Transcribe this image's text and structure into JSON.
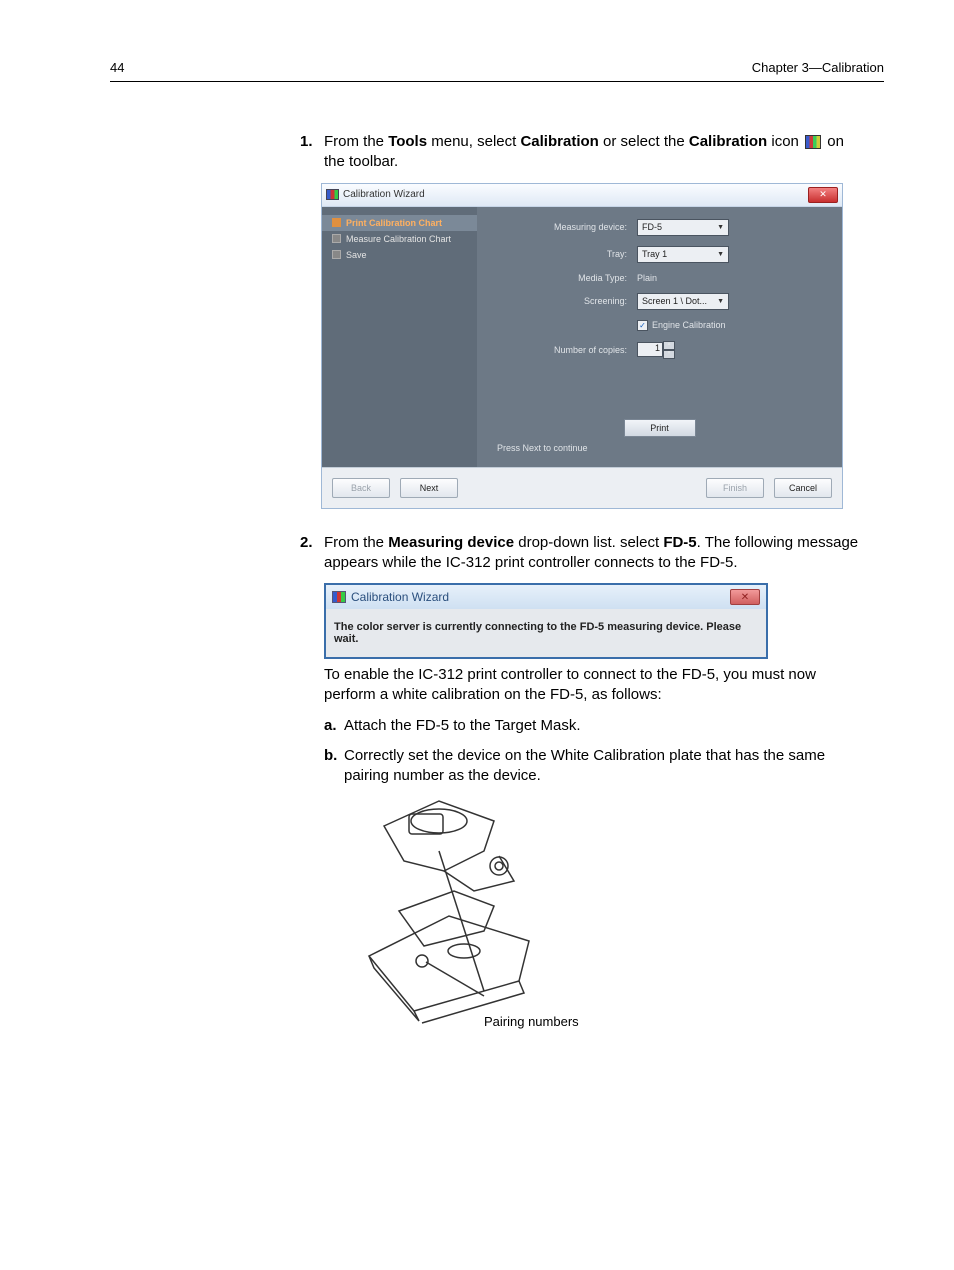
{
  "header": {
    "page_number": "44",
    "chapter": "Chapter 3—Calibration"
  },
  "step1": {
    "num": "1.",
    "t1": "From the ",
    "b1": "Tools",
    "t2": " menu, select ",
    "b2": "Calibration",
    "t3": " or select the ",
    "b3": "Calibration",
    "t4": " icon ",
    "t5": " on the toolbar."
  },
  "dialog1": {
    "title": "Calibration Wizard",
    "steps": {
      "s1": "Print Calibration Chart",
      "s2": "Measure Calibration Chart",
      "s3": "Save"
    },
    "labels": {
      "measuring_device": "Measuring device:",
      "tray": "Tray:",
      "media_type": "Media Type:",
      "screening": "Screening:",
      "engine_calibration": "Engine Calibration",
      "num_copies": "Number of copies:",
      "press_next": "Press Next to continue"
    },
    "values": {
      "measuring_device": "FD-5",
      "tray": "Tray 1",
      "media_type": "Plain",
      "screening": "Screen 1 \\ Dot...",
      "num_copies": "1"
    },
    "buttons": {
      "print": "Print",
      "back": "Back",
      "next": "Next",
      "finish": "Finish",
      "cancel": "Cancel"
    }
  },
  "step2": {
    "num": "2.",
    "t1": "From the ",
    "b1": "Measuring device",
    "t2": " drop-down list. select ",
    "b2": "FD-5",
    "t3": ". The following message appears while the IC-312 print controller connects to the FD-5."
  },
  "dialog2": {
    "title": "Calibration Wizard",
    "message": "The color server is currently connecting to the FD-5 measuring device. Please wait."
  },
  "after2": "To enable the IC-312 print controller to connect to the FD-5, you must now perform a white calibration on the FD-5, as follows:",
  "sub_a": {
    "letter": "a.",
    "text": "Attach the FD-5 to the Target Mask."
  },
  "sub_b": {
    "letter": "b.",
    "text": "Correctly set the device on the White Calibration plate that has the same pairing number as the device."
  },
  "illust_caption": "Pairing numbers"
}
